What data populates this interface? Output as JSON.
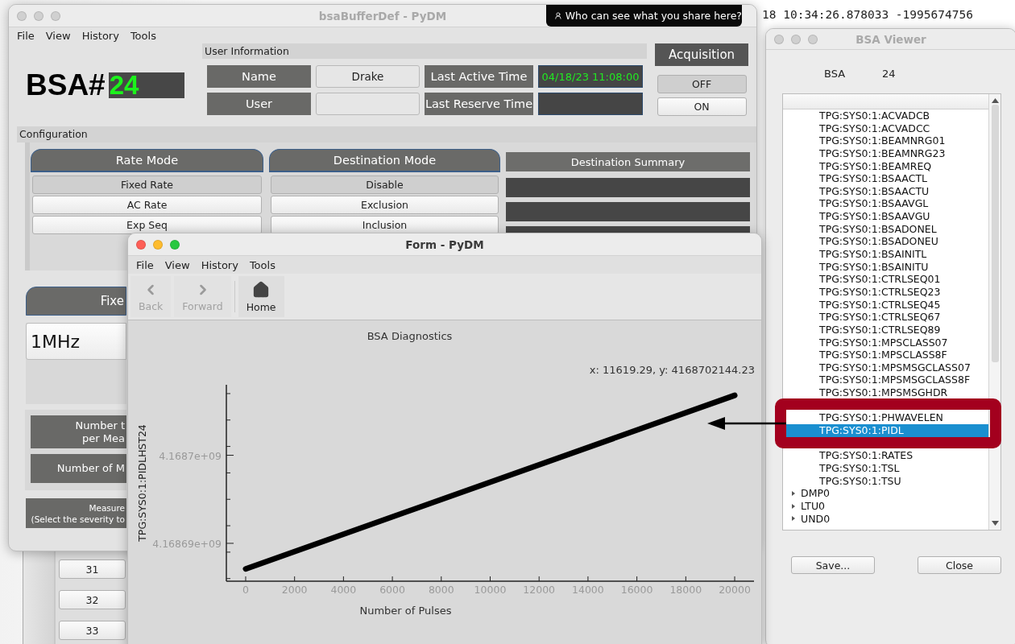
{
  "desktop": {
    "terminal_line": "18 10:34:26.878033 -1995674756"
  },
  "share_banner": {
    "text": "Who can see what you share here?"
  },
  "main_window": {
    "title": "bsaBufferDef - PyDM",
    "menu": [
      "File",
      "View",
      "History",
      "Tools"
    ],
    "bsa_label": "BSA#",
    "bsa_number": "24",
    "user_info": {
      "title": "User Information",
      "rows": [
        {
          "label": "Name",
          "value": "Drake",
          "time_label": "Last Active Time",
          "time_value": "04/18/23 11:08:00"
        },
        {
          "label": "User",
          "time_label": "Last Reserve Time"
        }
      ]
    },
    "acquisition": {
      "title": "Acquisition",
      "buttons": [
        {
          "label": "OFF",
          "selected": true
        },
        {
          "label": "ON",
          "selected": false
        }
      ]
    },
    "configuration": {
      "title": "Configuration",
      "rate_mode": {
        "title": "Rate Mode",
        "options": [
          {
            "label": "Fixed Rate",
            "selected": true
          },
          {
            "label": "AC Rate",
            "selected": false
          },
          {
            "label": "Exp Seq",
            "selected": false
          }
        ]
      },
      "destination_mode": {
        "title": "Destination Mode",
        "options": [
          {
            "label": "Disable",
            "selected": true
          },
          {
            "label": "Exclusion",
            "selected": false
          },
          {
            "label": "Inclusion",
            "selected": false
          }
        ]
      },
      "destination_summary": {
        "title": "Destination Summary"
      }
    },
    "fixed_rate": {
      "tab": "Fixe",
      "value": "1MHz"
    },
    "measurement_labels": [
      {
        "lines": [
          "Number t",
          "per Mea"
        ]
      },
      {
        "lines": [
          "Number of M"
        ]
      }
    ],
    "severity_note": {
      "lines": [
        "Measure",
        "(Select the severity to"
      ]
    }
  },
  "background_window": {
    "buttons": [
      "31",
      "32",
      "33"
    ]
  },
  "form_window": {
    "title": "Form - PyDM",
    "menu": [
      "File",
      "View",
      "History",
      "Tools"
    ],
    "toolbar": [
      {
        "kind": "back",
        "label": "Back",
        "disabled": true
      },
      {
        "kind": "forward",
        "label": "Forward",
        "disabled": true
      },
      {
        "kind": "home",
        "label": "Home",
        "disabled": false
      }
    ],
    "plot": {
      "cursor_readout": "x: 11619.29, y: 4168702144.23",
      "chart_data": {
        "type": "line",
        "title": "BSA Diagnostics",
        "xlabel": "Number of Pulses",
        "ylabel": "TPG:SYS0:1:PIDLHST24",
        "x": [
          0,
          20000
        ],
        "series": [
          {
            "color": "#000000",
            "values": [
              4168687100,
              4168706800
            ]
          }
        ],
        "xlim": [
          -790,
          20790
        ],
        "ylim": [
          4168685700,
          4168708000
        ],
        "xticks": [
          0,
          2000,
          4000,
          6000,
          8000,
          10000,
          12000,
          14000,
          16000,
          18000,
          20000
        ],
        "yticks": [
          {
            "value": 4168690000,
            "label": "4.16869e+09"
          },
          {
            "value": 4168700000,
            "label": "4.1687e+09"
          }
        ]
      }
    }
  },
  "bsa_viewer": {
    "title": "BSA Viewer",
    "bsa_label": "BSA",
    "bsa_number": "24",
    "tree": [
      {
        "kind": "leaf",
        "label": "TPG:SYS0:1:ACVADCB",
        "selected": false
      },
      {
        "kind": "leaf",
        "label": "TPG:SYS0:1:ACVADCC",
        "selected": false
      },
      {
        "kind": "leaf",
        "label": "TPG:SYS0:1:BEAMNRG01",
        "selected": false
      },
      {
        "kind": "leaf",
        "label": "TPG:SYS0:1:BEAMNRG23",
        "selected": false
      },
      {
        "kind": "leaf",
        "label": "TPG:SYS0:1:BEAMREQ",
        "selected": false
      },
      {
        "kind": "leaf",
        "label": "TPG:SYS0:1:BSAACTL",
        "selected": false
      },
      {
        "kind": "leaf",
        "label": "TPG:SYS0:1:BSAACTU",
        "selected": false
      },
      {
        "kind": "leaf",
        "label": "TPG:SYS0:1:BSAAVGL",
        "selected": false
      },
      {
        "kind": "leaf",
        "label": "TPG:SYS0:1:BSAAVGU",
        "selected": false
      },
      {
        "kind": "leaf",
        "label": "TPG:SYS0:1:BSADONEL",
        "selected": false
      },
      {
        "kind": "leaf",
        "label": "TPG:SYS0:1:BSADONEU",
        "selected": false
      },
      {
        "kind": "leaf",
        "label": "TPG:SYS0:1:BSAINITL",
        "selected": false
      },
      {
        "kind": "leaf",
        "label": "TPG:SYS0:1:BSAINITU",
        "selected": false
      },
      {
        "kind": "leaf",
        "label": "TPG:SYS0:1:CTRLSEQ01",
        "selected": false
      },
      {
        "kind": "leaf",
        "label": "TPG:SYS0:1:CTRLSEQ23",
        "selected": false
      },
      {
        "kind": "leaf",
        "label": "TPG:SYS0:1:CTRLSEQ45",
        "selected": false
      },
      {
        "kind": "leaf",
        "label": "TPG:SYS0:1:CTRLSEQ67",
        "selected": false
      },
      {
        "kind": "leaf",
        "label": "TPG:SYS0:1:CTRLSEQ89",
        "selected": false
      },
      {
        "kind": "leaf",
        "label": "TPG:SYS0:1:MPSCLASS07",
        "selected": false
      },
      {
        "kind": "leaf",
        "label": "TPG:SYS0:1:MPSCLASS8F",
        "selected": false
      },
      {
        "kind": "leaf",
        "label": "TPG:SYS0:1:MPSMSGCLASS07",
        "selected": false
      },
      {
        "kind": "leaf",
        "label": "TPG:SYS0:1:MPSMSGCLASS8F",
        "selected": false
      },
      {
        "kind": "leaf",
        "label": "TPG:SYS0:1:MPSMSGHDR",
        "selected": false
      },
      {
        "kind": "covered"
      },
      {
        "kind": "leaf",
        "label": "TPG:SYS0:1:PHWAVELEN",
        "selected": false
      },
      {
        "kind": "leaf",
        "label": "TPG:SYS0:1:PIDL",
        "selected": true
      },
      {
        "kind": "covered"
      },
      {
        "kind": "leaf",
        "label": "TPG:SYS0:1:RATES",
        "selected": false
      },
      {
        "kind": "leaf",
        "label": "TPG:SYS0:1:TSL",
        "selected": false
      },
      {
        "kind": "leaf",
        "label": "TPG:SYS0:1:TSU",
        "selected": false
      },
      {
        "kind": "group",
        "label": "DMP0",
        "expanded": false
      },
      {
        "kind": "group",
        "label": "LTU0",
        "expanded": false
      },
      {
        "kind": "group",
        "label": "UND0",
        "expanded": false
      }
    ],
    "buttons": [
      "Save...",
      "Close"
    ]
  }
}
